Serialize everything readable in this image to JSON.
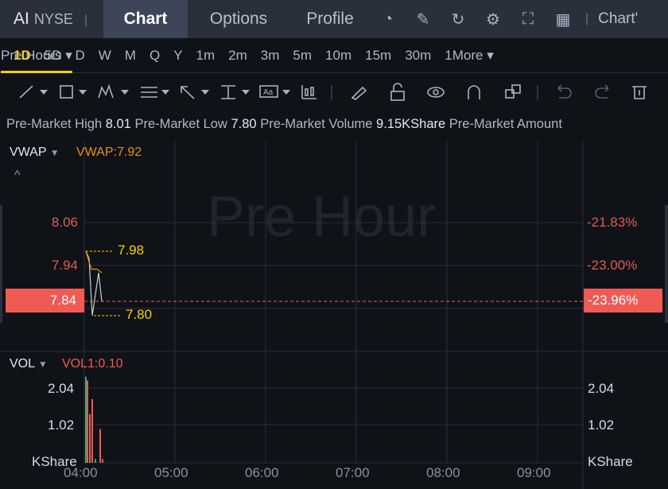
{
  "header": {
    "symbol": "AI",
    "exchange": "NYSE",
    "tabs": [
      "Chart",
      "Options",
      "Profile"
    ],
    "active_tab": "Chart",
    "right_label": "Chart'",
    "icons": [
      "speedometer-icon",
      "edit-icon",
      "refresh-icon",
      "gear-icon",
      "fullscreen-icon",
      "grid-layout-icon"
    ]
  },
  "timeframes": [
    "1D",
    "5D",
    "D",
    "W",
    "M",
    "Q",
    "Y",
    "1m",
    "2m",
    "3m",
    "5m",
    "10m",
    "15m",
    "30m",
    "1More ▾"
  ],
  "session": "Pre Hours ▾",
  "tools": [
    "line-tool-icon",
    "rectangle-tool-icon",
    "pattern-tool-icon",
    "fib-tool-icon",
    "arrow-tool-icon",
    "measure-tool-icon",
    "text-tool-icon",
    "candle-type-icon",
    "pen-icon",
    "unlock-icon",
    "eye-icon",
    "magnet-icon",
    "layers-icon",
    "undo-icon",
    "redo-icon",
    "trash-icon"
  ],
  "info": {
    "high_label": "Pre-Market High",
    "high": "8.01",
    "low_label": "Pre-Market Low",
    "low": "7.80",
    "vol_label": "Pre-Market Volume",
    "vol": "9.15KShare",
    "amount_label": "Pre-Market Amount"
  },
  "price_panel": {
    "indicator": "VWAP",
    "indicator_value": "VWAP:7.92",
    "watermark": "Pre Hour",
    "y_ticks": [
      "8.06",
      "7.94"
    ],
    "pct_ticks": [
      "-21.83%",
      "-23.00%"
    ],
    "current_price": "7.84",
    "current_pct": "-23.96%",
    "high_mark": "7.98",
    "low_mark": "7.80"
  },
  "vol_panel": {
    "indicator": "VOL",
    "indicator_value": "VOL1:0.10",
    "y_ticks": [
      "2.04",
      "1.02"
    ],
    "unit": "KShare"
  },
  "x_ticks": [
    "04:00",
    "05:00",
    "06:00",
    "07:00",
    "08:00",
    "09:00"
  ],
  "colors": {
    "up": "#f05a55",
    "down": "#22b573",
    "accent": "#f5d000",
    "vwap": "#e8920c"
  },
  "chart_data": {
    "type": "line",
    "price": [
      7.98,
      7.96,
      7.8,
      7.92,
      7.84
    ],
    "vwap": [
      7.98,
      7.95,
      7.93,
      7.93,
      7.92
    ],
    "volume": [
      2.3,
      2.2,
      1.3,
      1.7,
      0.1,
      0.9,
      0.1
    ]
  }
}
